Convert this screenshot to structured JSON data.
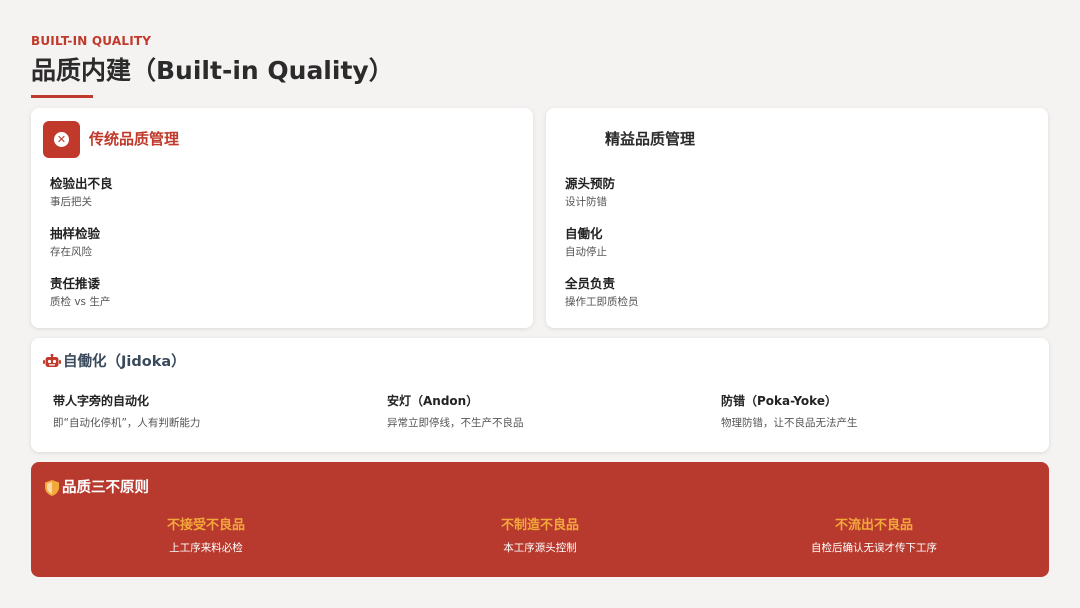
{
  "header": {
    "eyebrow": "BUILT-IN QUALITY",
    "title": "品质内建（Built-in Quality）"
  },
  "traditional": {
    "icon": "x-circle-icon",
    "title": "传统品质管理",
    "items": [
      {
        "title": "检验出不良",
        "desc": "事后把关"
      },
      {
        "title": "抽样检验",
        "desc": "存在风险"
      },
      {
        "title": "责任推诿",
        "desc": "质检 vs 生产"
      }
    ]
  },
  "lean": {
    "title": "精益品质管理",
    "items": [
      {
        "title": "源头预防",
        "desc": "设计防错"
      },
      {
        "title": "自働化",
        "desc": "自动停止"
      },
      {
        "title": "全员负责",
        "desc": "操作工即质检员"
      }
    ]
  },
  "jidoka": {
    "icon": "robot-icon",
    "title": "自働化（Jidoka）",
    "columns": [
      {
        "title": "带人字旁的自动化",
        "desc": "即“自动化停机”，人有判断能力"
      },
      {
        "title": "安灯（Andon）",
        "desc": "异常立即停线，不生产不良品"
      },
      {
        "title": "防错（Poka-Yoke）",
        "desc": "物理防错，让不良品无法产生"
      }
    ]
  },
  "principles": {
    "icon": "shield-icon",
    "title": "品质三不原则",
    "columns": [
      {
        "title": "不接受不良品",
        "desc": "上工序来料必检"
      },
      {
        "title": "不制造不良品",
        "desc": "本工序源头控制"
      },
      {
        "title": "不流出不良品",
        "desc": "自检后确认无误才传下工序"
      }
    ]
  },
  "colors": {
    "accent": "#c0392b",
    "banner": "#b83a2e",
    "highlight": "#f3a83a",
    "background": "#f5f3f2"
  }
}
